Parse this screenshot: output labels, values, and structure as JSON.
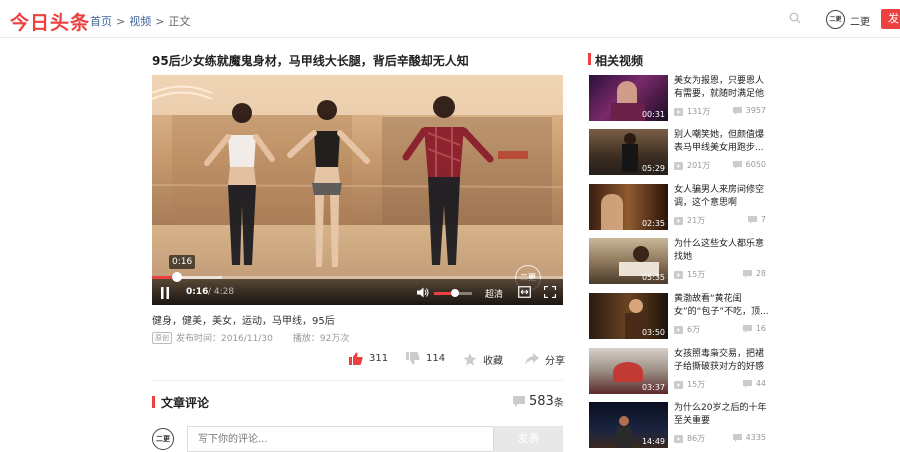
{
  "header": {
    "logo": "今日头条",
    "breadcrumb": {
      "home": "首页",
      "section": "视频",
      "current": "正文",
      "separator": ">"
    },
    "user_avatar_text": "二更",
    "user_name": "二更",
    "post_button": "发"
  },
  "article": {
    "title": "95后少女练就魔鬼身材，马甲线大长腿，背后辛酸却无人知",
    "tags": "健身，健美，美女，运动，马甲线，95后",
    "source_badge": "原创",
    "publish_time": "发布时间：2016/11/30",
    "play_count": "播放：92万次"
  },
  "player": {
    "hover_time": "0:16",
    "current_time": "0:16",
    "duration": "/ 4:28",
    "quality": "超清",
    "progress_fraction": 0.06,
    "buffered_fraction": 0.17,
    "volume_fraction": 0.55,
    "watermark": "二更",
    "brand_color": "#ed4040"
  },
  "actions": {
    "like_count": "311",
    "dislike_count": "114",
    "favorite_label": "收藏",
    "share_label": "分享"
  },
  "comments": {
    "section_title": "文章评论",
    "count": "583",
    "count_unit": "条",
    "avatar_text": "二更",
    "input_placeholder": "写下你的评论...",
    "submit_label": "发表"
  },
  "sidebar": {
    "title": "相关视频",
    "items": [
      {
        "title": "美女为报恩，只要恩人有需要，就随时满足他",
        "duration": "00:31",
        "views": "131万",
        "comments": "3957"
      },
      {
        "title": "别人嘲笑她，但颜值爆表马甲线美女用跑步...",
        "duration": "05:29",
        "views": "201万",
        "comments": "6050"
      },
      {
        "title": "女人骗男人来房间修空调，这个意思啊",
        "duration": "02:35",
        "views": "21万",
        "comments": "7"
      },
      {
        "title": "为什么这些女人都乐意找她",
        "duration": "05:35",
        "views": "15万",
        "comments": "28"
      },
      {
        "title": "黄渤故看“黄花闺女”的“包子”不吃，顶...",
        "duration": "03:50",
        "views": "6万",
        "comments": "16"
      },
      {
        "title": "女孩照毒枭交易，把裙子给撕破获对方的好感",
        "duration": "03:37",
        "views": "15万",
        "comments": "44"
      },
      {
        "title": "为什么20岁之后的十年至关重要",
        "duration": "14:49",
        "views": "86万",
        "comments": "4335"
      }
    ]
  }
}
